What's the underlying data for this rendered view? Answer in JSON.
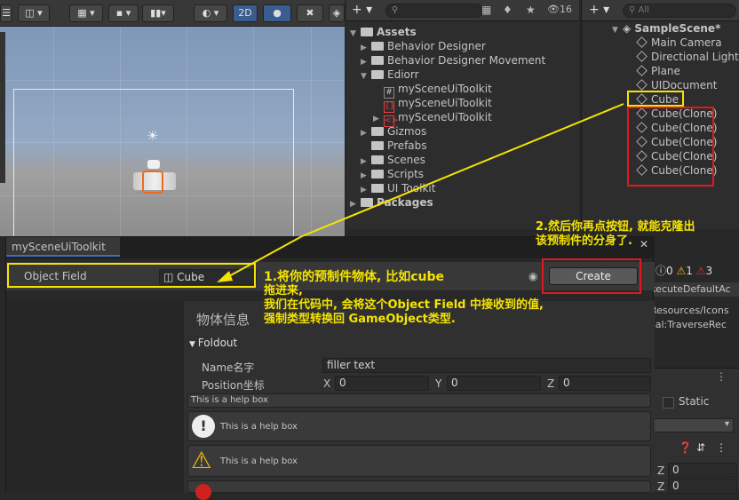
{
  "scene": {
    "mode_2d_label": "2D"
  },
  "project": {
    "search_badge": "16",
    "tree": [
      {
        "label": "Assets",
        "bold": true
      },
      {
        "label": "Behavior Designer"
      },
      {
        "label": "Behavior Designer Movement"
      },
      {
        "label": "Ediorr"
      },
      {
        "label": "mySceneUiToolkit"
      },
      {
        "label": "mySceneUiToolkit"
      },
      {
        "label": "mySceneUiToolkit"
      },
      {
        "label": "Gizmos"
      },
      {
        "label": "Prefabs"
      },
      {
        "label": "Scenes"
      },
      {
        "label": "Scripts"
      },
      {
        "label": "UI Toolkit"
      },
      {
        "label": "Packages"
      }
    ]
  },
  "hierarchy": {
    "search_placeholder": "All",
    "scene_name": "SampleScene*",
    "items": [
      "Main Camera",
      "Directional Light",
      "Plane",
      "UIDocument",
      "Cube",
      "Cube(Clone)",
      "Cube(Clone)",
      "Cube(Clone)",
      "Cube(Clone)",
      "Cube(Clone)"
    ]
  },
  "console": {
    "count_info": "0",
    "count_warn": "1",
    "count_error": "3",
    "lines": [
      "xecuteDefaultAc",
      "Resources/Icons",
      "sal:TraverseRec"
    ]
  },
  "inspector": {
    "static_label": "Static",
    "z_label": "Z",
    "z_value1": "0",
    "z_value2": "0"
  },
  "editor": {
    "tab_title": "mySceneUiToolkit",
    "object_field_label": "Object Field",
    "object_field_value": "Cube",
    "create_label": "Create",
    "section_title": "物体信息",
    "foldout_label": "Foldout",
    "name_label": "Name名字",
    "name_value": "filler text",
    "position_label": "Position坐标",
    "pos_x_label": "X",
    "pos_x": "0",
    "pos_y_label": "Y",
    "pos_y": "0",
    "pos_z_label": "Z",
    "pos_z": "0",
    "helpbox_plain": "This is a help box",
    "helpbox_info": "This is a help box",
    "helpbox_warning": "This is a help box"
  },
  "annotations": {
    "note1_line1": "1.将你的预制件物体, 比如cube",
    "note1_line2": "拖进来,",
    "note1_line3": "我们在代码中, 会将这个Object Field 中接收到的值,",
    "note1_line4": "强制类型转换回 GameObject类型.",
    "note2_line1": "2.然后你再点按钮, 就能克隆出",
    "note2_line2": "该预制件的分身了."
  },
  "colors": {
    "annotation": "#f5e400",
    "highlight_red": "#e0191f",
    "accent_blue": "#3a6fc1"
  }
}
